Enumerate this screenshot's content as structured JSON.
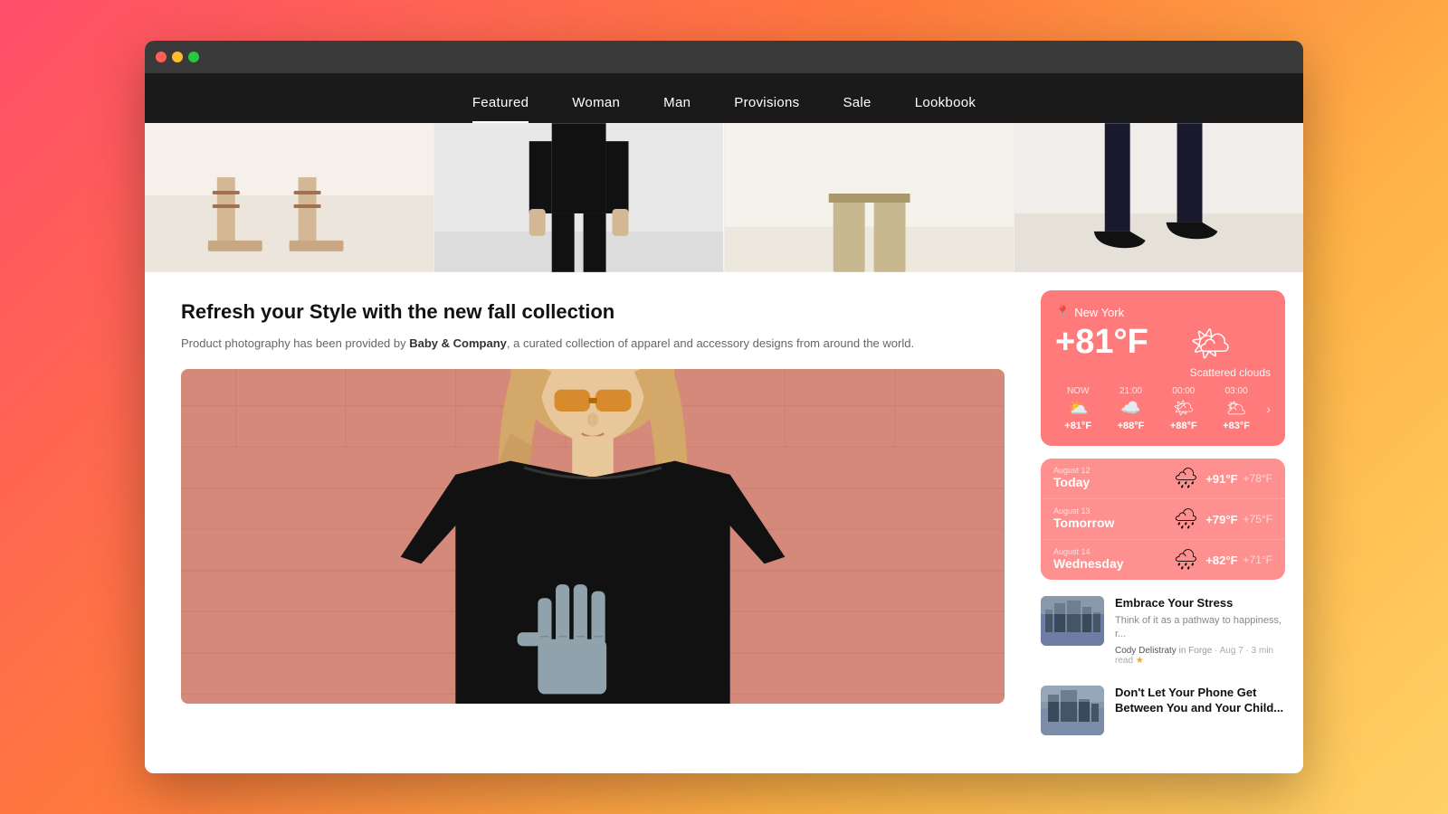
{
  "browser": {
    "dots": [
      "red",
      "yellow",
      "green"
    ]
  },
  "nav": {
    "items": [
      {
        "label": "Featured",
        "active": true
      },
      {
        "label": "Woman",
        "active": false
      },
      {
        "label": "Man",
        "active": false
      },
      {
        "label": "Provisions",
        "active": false
      },
      {
        "label": "Sale",
        "active": false
      },
      {
        "label": "Lookbook",
        "active": false
      }
    ]
  },
  "main": {
    "title": "Refresh your Style with the new fall collection",
    "subtitle_prefix": "Product photography has been provided by ",
    "subtitle_brand": "Baby & Company",
    "subtitle_suffix": ", a curated collection of apparel and accessory designs from around the world."
  },
  "weather": {
    "location": "New York",
    "temperature": "+81°F",
    "description": "Scattered clouds",
    "hourly": [
      {
        "time": "NOW",
        "icon": "⛅",
        "temp": "+81°F"
      },
      {
        "time": "21:00",
        "icon": "☁️",
        "temp": "+88°F"
      },
      {
        "time": "00:00",
        "icon": "🌤",
        "temp": "+88°F"
      },
      {
        "time": "03:00",
        "icon": "🌥",
        "temp": "+83°F"
      }
    ],
    "forecast": [
      {
        "date_label": "August 12",
        "day": "Today",
        "icon": "🌧",
        "high": "+91°F",
        "low": "+78°F"
      },
      {
        "date_label": "August 13",
        "day": "Tomorrow",
        "icon": "🌧",
        "high": "+79°F",
        "low": "+75°F"
      },
      {
        "date_label": "August 14",
        "day": "Wednesday",
        "icon": "🌧",
        "high": "+82°F",
        "low": "+71°F"
      }
    ]
  },
  "blog": {
    "posts": [
      {
        "title": "Embrace Your Stress",
        "excerpt": "Think of it as a pathway to happiness, r...",
        "author": "Cody Delistraty",
        "source": "in Forge",
        "date": "Aug 7",
        "read_time": "3 min read",
        "star": "★"
      },
      {
        "title": "Don't Let Your Phone Get Between You and Your Child...",
        "excerpt": "",
        "author": "",
        "source": "",
        "date": "",
        "read_time": "",
        "star": ""
      }
    ]
  }
}
